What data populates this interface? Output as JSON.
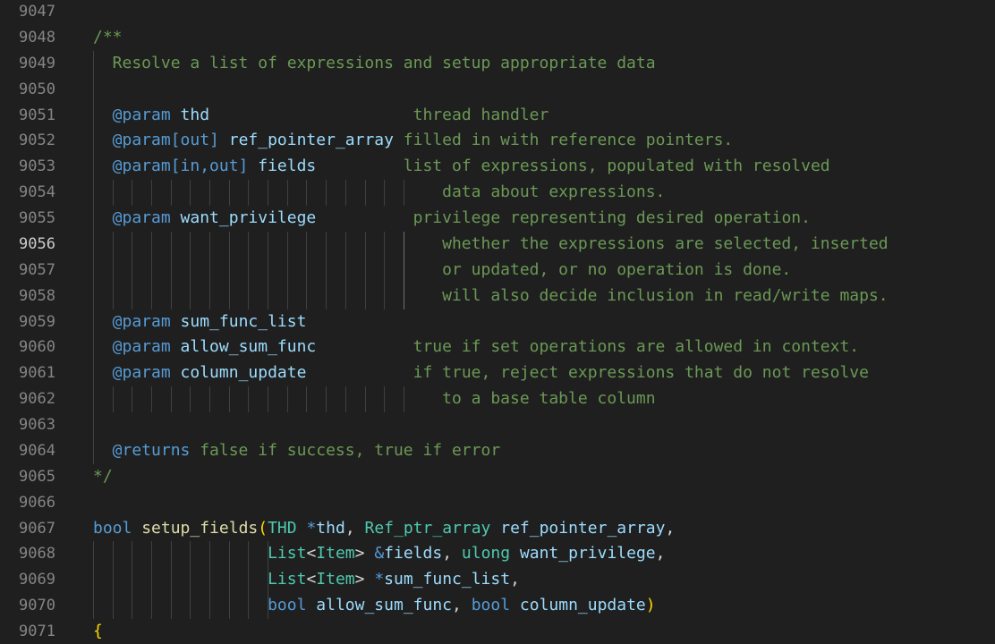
{
  "editor": {
    "active_line": "9056",
    "colors": {
      "background": "#1f1f1f",
      "line_number": "#858585",
      "active_line_number": "#cccccc",
      "comment": "#6a9955",
      "doc_tag": "#569cd6",
      "param_name": "#9cdcfe",
      "keyword": "#569cd6",
      "type": "#4ec9b0",
      "function": "#dcdcaa",
      "bracket": "#ffd700"
    },
    "lines": [
      {
        "number": "9047",
        "tokens": []
      },
      {
        "number": "9048",
        "tokens": [
          {
            "t": "/**",
            "k": "comment"
          }
        ]
      },
      {
        "number": "9049",
        "tokens": [
          {
            "t": "  Resolve a list of expressions and setup appropriate data",
            "k": "comment"
          }
        ]
      },
      {
        "number": "9050",
        "tokens": []
      },
      {
        "number": "9051",
        "tokens": [
          {
            "t": "  @param",
            "k": "tag"
          },
          {
            "t": " ",
            "k": "comment"
          },
          {
            "t": "thd",
            "k": "param"
          },
          {
            "t": "                     thread handler",
            "k": "comment"
          }
        ]
      },
      {
        "number": "9052",
        "tokens": [
          {
            "t": "  @param[out]",
            "k": "tag"
          },
          {
            "t": " ",
            "k": "comment"
          },
          {
            "t": "ref_pointer_array",
            "k": "param"
          },
          {
            "t": " filled in with reference pointers.",
            "k": "comment"
          }
        ]
      },
      {
        "number": "9053",
        "tokens": [
          {
            "t": "  @param[in,out]",
            "k": "tag"
          },
          {
            "t": " ",
            "k": "comment"
          },
          {
            "t": "fields",
            "k": "param"
          },
          {
            "t": "         list of expressions, populated with resolved",
            "k": "comment"
          }
        ]
      },
      {
        "number": "9054",
        "tokens": [
          {
            "t": "                                    data about expressions.",
            "k": "comment"
          }
        ]
      },
      {
        "number": "9055",
        "tokens": [
          {
            "t": "  @param",
            "k": "tag"
          },
          {
            "t": " ",
            "k": "comment"
          },
          {
            "t": "want_privilege",
            "k": "param"
          },
          {
            "t": "          privilege representing desired operation.",
            "k": "comment"
          }
        ]
      },
      {
        "number": "9056",
        "tokens": [
          {
            "t": "                                    whether the expressions are selected, inserted",
            "k": "comment"
          }
        ]
      },
      {
        "number": "9057",
        "tokens": [
          {
            "t": "                                    or updated, or no operation is done.",
            "k": "comment"
          }
        ]
      },
      {
        "number": "9058",
        "tokens": [
          {
            "t": "                                    will also decide inclusion in read/write maps.",
            "k": "comment"
          }
        ]
      },
      {
        "number": "9059",
        "tokens": [
          {
            "t": "  @param",
            "k": "tag"
          },
          {
            "t": " ",
            "k": "comment"
          },
          {
            "t": "sum_func_list",
            "k": "param"
          }
        ]
      },
      {
        "number": "9060",
        "tokens": [
          {
            "t": "  @param",
            "k": "tag"
          },
          {
            "t": " ",
            "k": "comment"
          },
          {
            "t": "allow_sum_func",
            "k": "param"
          },
          {
            "t": "          true if set operations are allowed in context.",
            "k": "comment"
          }
        ]
      },
      {
        "number": "9061",
        "tokens": [
          {
            "t": "  @param",
            "k": "tag"
          },
          {
            "t": " ",
            "k": "comment"
          },
          {
            "t": "column_update",
            "k": "param"
          },
          {
            "t": "           if true, reject expressions that do not resolve",
            "k": "comment"
          }
        ]
      },
      {
        "number": "9062",
        "tokens": [
          {
            "t": "                                    to a base table column",
            "k": "comment"
          }
        ]
      },
      {
        "number": "9063",
        "tokens": []
      },
      {
        "number": "9064",
        "tokens": [
          {
            "t": "  @returns",
            "k": "tag"
          },
          {
            "t": " false if success, true if error",
            "k": "comment"
          }
        ]
      },
      {
        "number": "9065",
        "tokens": [
          {
            "t": "*/",
            "k": "comment"
          }
        ]
      },
      {
        "number": "9066",
        "tokens": []
      },
      {
        "number": "9067",
        "tokens": [
          {
            "t": "bool",
            "k": "kw"
          },
          {
            "t": " ",
            "k": "plain"
          },
          {
            "t": "setup_fields",
            "k": "fn"
          },
          {
            "t": "(",
            "k": "brace"
          },
          {
            "t": "THD",
            "k": "type"
          },
          {
            "t": " ",
            "k": "plain"
          },
          {
            "t": "*",
            "k": "kw"
          },
          {
            "t": "thd",
            "k": "var"
          },
          {
            "t": ", ",
            "k": "plain"
          },
          {
            "t": "Ref_ptr_array",
            "k": "type"
          },
          {
            "t": " ",
            "k": "plain"
          },
          {
            "t": "ref_pointer_array",
            "k": "var"
          },
          {
            "t": ",",
            "k": "plain"
          }
        ]
      },
      {
        "number": "9068",
        "tokens": [
          {
            "t": "                  ",
            "k": "plain"
          },
          {
            "t": "List",
            "k": "type"
          },
          {
            "t": "<",
            "k": "op"
          },
          {
            "t": "Item",
            "k": "type"
          },
          {
            "t": ">",
            "k": "op"
          },
          {
            "t": " ",
            "k": "plain"
          },
          {
            "t": "&",
            "k": "kw"
          },
          {
            "t": "fields",
            "k": "var"
          },
          {
            "t": ", ",
            "k": "plain"
          },
          {
            "t": "ulong",
            "k": "type"
          },
          {
            "t": " ",
            "k": "plain"
          },
          {
            "t": "want_privilege",
            "k": "var"
          },
          {
            "t": ",",
            "k": "plain"
          }
        ]
      },
      {
        "number": "9069",
        "tokens": [
          {
            "t": "                  ",
            "k": "plain"
          },
          {
            "t": "List",
            "k": "type"
          },
          {
            "t": "<",
            "k": "op"
          },
          {
            "t": "Item",
            "k": "type"
          },
          {
            "t": ">",
            "k": "op"
          },
          {
            "t": " ",
            "k": "plain"
          },
          {
            "t": "*",
            "k": "kw"
          },
          {
            "t": "sum_func_list",
            "k": "var"
          },
          {
            "t": ",",
            "k": "plain"
          }
        ]
      },
      {
        "number": "9070",
        "tokens": [
          {
            "t": "                  ",
            "k": "plain"
          },
          {
            "t": "bool",
            "k": "kw"
          },
          {
            "t": " ",
            "k": "plain"
          },
          {
            "t": "allow_sum_func",
            "k": "var"
          },
          {
            "t": ", ",
            "k": "plain"
          },
          {
            "t": "bool",
            "k": "kw"
          },
          {
            "t": " ",
            "k": "plain"
          },
          {
            "t": "column_update",
            "k": "var"
          },
          {
            "t": ")",
            "k": "brace"
          }
        ]
      },
      {
        "number": "9071",
        "tokens": [
          {
            "t": "{",
            "k": "brace"
          }
        ]
      }
    ]
  }
}
